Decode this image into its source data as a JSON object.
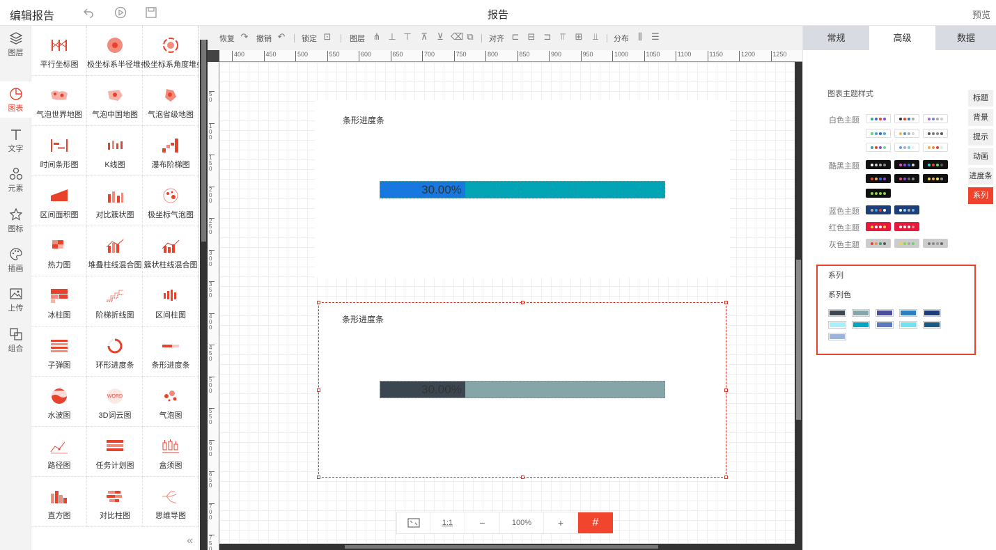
{
  "topbar": {
    "app_title": "编辑报告",
    "doc_title": "报告",
    "preview": "预览",
    "icons": [
      "undo-icon",
      "play-icon",
      "save-icon"
    ]
  },
  "rail": {
    "items": [
      {
        "label": "图层",
        "icon": "layers-icon"
      },
      {
        "label": "图表",
        "icon": "chart-pie-icon"
      },
      {
        "label": "文字",
        "icon": "text-icon"
      },
      {
        "label": "元素",
        "icon": "elements-icon"
      },
      {
        "label": "图标",
        "icon": "star-icon"
      },
      {
        "label": "插画",
        "icon": "palette-icon"
      },
      {
        "label": "上传",
        "icon": "image-upload-icon"
      },
      {
        "label": "组合",
        "icon": "group-icon"
      }
    ],
    "active_index": 1
  },
  "components": [
    "平行坐标图",
    "极坐标系半径堆叠柱状图",
    "极坐标系角度堆叠柱状图",
    "气泡世界地图",
    "气泡中国地图",
    "气泡省级地图",
    "时间条形图",
    "K线图",
    "瀑布阶梯图",
    "区间面积图",
    "对比簇状图",
    "极坐标气泡图",
    "热力图",
    "堆叠柱线混合图",
    "簇状柱线混合图",
    "冰柱图",
    "阶梯折线图",
    "区间柱图",
    "子弹图",
    "环形进度条",
    "条形进度条",
    "水波图",
    "3D词云图",
    "气泡图",
    "路径图",
    "任务计划图",
    "盒须图",
    "直方图",
    "对比柱图",
    "思维导图"
  ],
  "toolbar": {
    "redo": "恢复",
    "undo": "撤销",
    "lock": "锁定",
    "layer": "图层",
    "align": "对齐",
    "distribute": "分布"
  },
  "ruler": {
    "h_ticks": [
      "400",
      "450",
      "500",
      "550",
      "600",
      "650",
      "700",
      "750",
      "800",
      "850",
      "900",
      "950",
      "1000",
      "1050",
      "1100",
      "1150",
      "1200",
      "1250"
    ],
    "v_ticks": [
      "50",
      "100",
      "150",
      "200",
      "250",
      "300",
      "350",
      "400",
      "450",
      "500",
      "550",
      "600",
      "650",
      "700",
      "750"
    ]
  },
  "widgets": [
    {
      "title": "条形进度条",
      "value_text": "30.00%",
      "progress": 0.3,
      "fill_color": "#1778e0",
      "track_color": "#00a4b4"
    },
    {
      "title": "条形进度条",
      "value_text": "30.00%",
      "progress": 0.3,
      "fill_color": "#3b4650",
      "track_color": "#86a5a8"
    }
  ],
  "zoom": {
    "fit": "fit-screen-icon",
    "one_to_one": "1:1",
    "minus": "−",
    "level": "100%",
    "plus": "+",
    "grid": "#"
  },
  "right_panel": {
    "tabs": [
      "常规",
      "高级",
      "数据"
    ],
    "active_tab": 1,
    "theme_section_title": "图表主题样式",
    "themes": [
      {
        "label": "白色主题",
        "rows": 3
      },
      {
        "label": "酷黑主题",
        "rows": 3
      },
      {
        "label": "蓝色主题",
        "rows": 1
      },
      {
        "label": "红色主题",
        "rows": 1
      },
      {
        "label": "灰色主题",
        "rows": 1
      }
    ],
    "side_tabs": [
      "标题",
      "背景",
      "提示",
      "动画",
      "进度条",
      "系列"
    ],
    "side_active": 5,
    "series_title": "系列",
    "series_color_title": "系列色",
    "series_colors": [
      "#3b4650",
      "#86a5a8",
      "#4a4e9a",
      "#2f7fc0",
      "#1c3d7a",
      "#a6f0fb",
      "#00a4c4",
      "#5b79c0",
      "#6fe4ef",
      "#1a5b86",
      "#9db3d8"
    ]
  }
}
